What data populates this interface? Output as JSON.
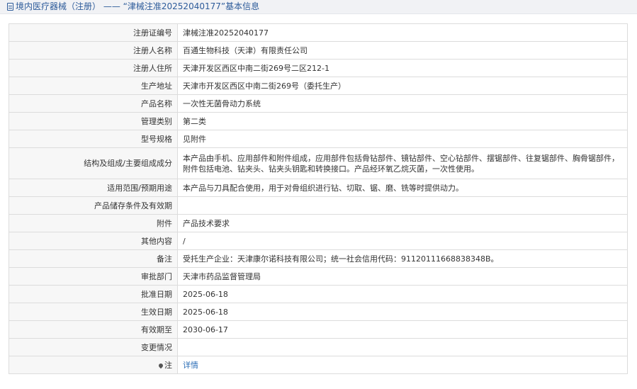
{
  "header": {
    "category": "境内医疗器械（注册）",
    "separator": "——",
    "title": "“津械注准20252040177”基本信息"
  },
  "rows": [
    {
      "label": "注册证编号",
      "value": "津械注准20252040177"
    },
    {
      "label": "注册人名称",
      "value": "百通生物科技（天津）有限责任公司"
    },
    {
      "label": "注册人住所",
      "value": "天津开发区西区中南二街269号二区212-1"
    },
    {
      "label": "生产地址",
      "value": "天津市开发区西区中南二街269号（委托生产）"
    },
    {
      "label": "产品名称",
      "value": "一次性无菌骨动力系统"
    },
    {
      "label": "管理类别",
      "value": "第二类"
    },
    {
      "label": "型号规格",
      "value": "见附件"
    },
    {
      "label": "结构及组成/主要组成成分",
      "value": "本产品由手机、应用部件和附件组成，应用部件包括骨钻部件、镜钻部件、空心钻部件、摆锯部件、往复锯部件、胸骨锯部件，附件包括电池、钻夹头、钻夹头钥匙和转换接口。产品经环氧乙烷灭菌，一次性使用。"
    },
    {
      "label": "适用范围/预期用途",
      "value": "本产品与刀具配合使用，用于对骨组织进行钻、切取、锯、磨、铣等时提供动力。"
    },
    {
      "label": "产品储存条件及有效期",
      "value": ""
    },
    {
      "label": "附件",
      "value": "产品技术要求"
    },
    {
      "label": "其他内容",
      "value": "/"
    },
    {
      "label": "备注",
      "value": "受托生产企业：天津康尔诺科技有限公司；统一社会信用代码：91120111668838348B。"
    },
    {
      "label": "审批部门",
      "value": "天津市药品监督管理局"
    },
    {
      "label": "批准日期",
      "value": "2025-06-18"
    },
    {
      "label": "生效日期",
      "value": "2025-06-18"
    },
    {
      "label": "有效期至",
      "value": "2030-06-17"
    },
    {
      "label": "变更情况",
      "value": ""
    }
  ],
  "note_row": {
    "label": "注",
    "link": "详情",
    "icon": "pin-icon"
  }
}
